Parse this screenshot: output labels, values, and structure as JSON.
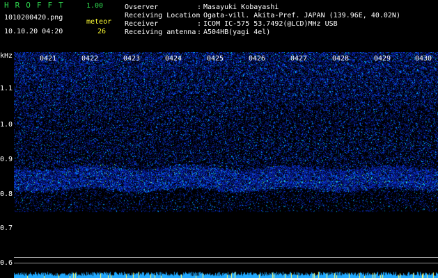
{
  "header": {
    "app_name": "HROFFT",
    "app_version": "1.00",
    "filename": "1010200420.png",
    "datetime": "10.10.20 04:20",
    "meteor_label": "meteor",
    "meteor_count": "26",
    "info": [
      {
        "label": "Ovserver",
        "value": "Masayuki Kobayashi"
      },
      {
        "label": "Receiving Location",
        "value": "Ogata-vill. Akita-Pref. JAPAN (139.96E, 40.02N)"
      },
      {
        "label": "Receiver",
        "value": "ICOM IC-575 53.7492(@LCD)MHz USB"
      },
      {
        "label": "Receiving antenna",
        "value": "A504HB(yagi 4el)"
      }
    ],
    "separator": ":"
  },
  "axis": {
    "unit": "kHz",
    "y_ticks": [
      "1.1",
      "1.0",
      "0.9",
      "0.8",
      "0.7",
      "0.6"
    ],
    "x_ticks": [
      "0421",
      "0422",
      "0423",
      "0424",
      "0425",
      "0426",
      "0427",
      "0428",
      "0429",
      "0430"
    ]
  },
  "colors": {
    "title_green": "#2fd94f",
    "meteor_yellow": "#ffff33",
    "spectrum_blue": "#1a3cff"
  }
}
